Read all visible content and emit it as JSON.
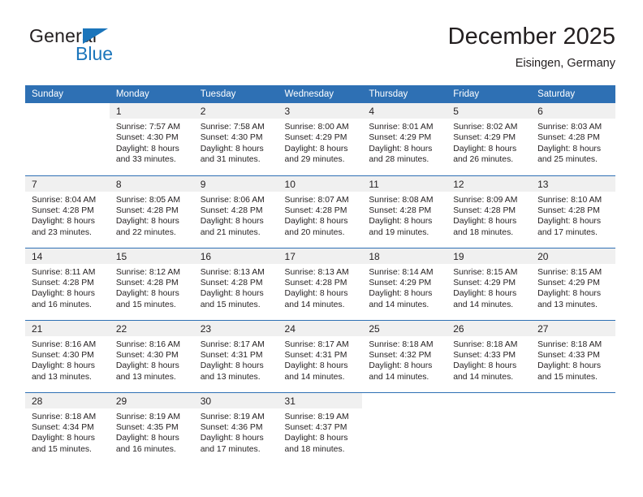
{
  "brand": {
    "name_top": "General",
    "name_bottom": "Blue",
    "triangle_color": "#1b75bb"
  },
  "header": {
    "title": "December 2025",
    "subtitle": "Eisingen, Germany"
  },
  "theme": {
    "header_blue": "#2e70b4",
    "daynum_band": "#f0f0f0",
    "text": "#231f20"
  },
  "weekdays": [
    "Sunday",
    "Monday",
    "Tuesday",
    "Wednesday",
    "Thursday",
    "Friday",
    "Saturday"
  ],
  "weeks": [
    [
      {
        "day": "",
        "lines": []
      },
      {
        "day": "1",
        "lines": [
          "Sunrise: 7:57 AM",
          "Sunset: 4:30 PM",
          "Daylight: 8 hours",
          "and 33 minutes."
        ]
      },
      {
        "day": "2",
        "lines": [
          "Sunrise: 7:58 AM",
          "Sunset: 4:30 PM",
          "Daylight: 8 hours",
          "and 31 minutes."
        ]
      },
      {
        "day": "3",
        "lines": [
          "Sunrise: 8:00 AM",
          "Sunset: 4:29 PM",
          "Daylight: 8 hours",
          "and 29 minutes."
        ]
      },
      {
        "day": "4",
        "lines": [
          "Sunrise: 8:01 AM",
          "Sunset: 4:29 PM",
          "Daylight: 8 hours",
          "and 28 minutes."
        ]
      },
      {
        "day": "5",
        "lines": [
          "Sunrise: 8:02 AM",
          "Sunset: 4:29 PM",
          "Daylight: 8 hours",
          "and 26 minutes."
        ]
      },
      {
        "day": "6",
        "lines": [
          "Sunrise: 8:03 AM",
          "Sunset: 4:28 PM",
          "Daylight: 8 hours",
          "and 25 minutes."
        ]
      }
    ],
    [
      {
        "day": "7",
        "lines": [
          "Sunrise: 8:04 AM",
          "Sunset: 4:28 PM",
          "Daylight: 8 hours",
          "and 23 minutes."
        ]
      },
      {
        "day": "8",
        "lines": [
          "Sunrise: 8:05 AM",
          "Sunset: 4:28 PM",
          "Daylight: 8 hours",
          "and 22 minutes."
        ]
      },
      {
        "day": "9",
        "lines": [
          "Sunrise: 8:06 AM",
          "Sunset: 4:28 PM",
          "Daylight: 8 hours",
          "and 21 minutes."
        ]
      },
      {
        "day": "10",
        "lines": [
          "Sunrise: 8:07 AM",
          "Sunset: 4:28 PM",
          "Daylight: 8 hours",
          "and 20 minutes."
        ]
      },
      {
        "day": "11",
        "lines": [
          "Sunrise: 8:08 AM",
          "Sunset: 4:28 PM",
          "Daylight: 8 hours",
          "and 19 minutes."
        ]
      },
      {
        "day": "12",
        "lines": [
          "Sunrise: 8:09 AM",
          "Sunset: 4:28 PM",
          "Daylight: 8 hours",
          "and 18 minutes."
        ]
      },
      {
        "day": "13",
        "lines": [
          "Sunrise: 8:10 AM",
          "Sunset: 4:28 PM",
          "Daylight: 8 hours",
          "and 17 minutes."
        ]
      }
    ],
    [
      {
        "day": "14",
        "lines": [
          "Sunrise: 8:11 AM",
          "Sunset: 4:28 PM",
          "Daylight: 8 hours",
          "and 16 minutes."
        ]
      },
      {
        "day": "15",
        "lines": [
          "Sunrise: 8:12 AM",
          "Sunset: 4:28 PM",
          "Daylight: 8 hours",
          "and 15 minutes."
        ]
      },
      {
        "day": "16",
        "lines": [
          "Sunrise: 8:13 AM",
          "Sunset: 4:28 PM",
          "Daylight: 8 hours",
          "and 15 minutes."
        ]
      },
      {
        "day": "17",
        "lines": [
          "Sunrise: 8:13 AM",
          "Sunset: 4:28 PM",
          "Daylight: 8 hours",
          "and 14 minutes."
        ]
      },
      {
        "day": "18",
        "lines": [
          "Sunrise: 8:14 AM",
          "Sunset: 4:29 PM",
          "Daylight: 8 hours",
          "and 14 minutes."
        ]
      },
      {
        "day": "19",
        "lines": [
          "Sunrise: 8:15 AM",
          "Sunset: 4:29 PM",
          "Daylight: 8 hours",
          "and 14 minutes."
        ]
      },
      {
        "day": "20",
        "lines": [
          "Sunrise: 8:15 AM",
          "Sunset: 4:29 PM",
          "Daylight: 8 hours",
          "and 13 minutes."
        ]
      }
    ],
    [
      {
        "day": "21",
        "lines": [
          "Sunrise: 8:16 AM",
          "Sunset: 4:30 PM",
          "Daylight: 8 hours",
          "and 13 minutes."
        ]
      },
      {
        "day": "22",
        "lines": [
          "Sunrise: 8:16 AM",
          "Sunset: 4:30 PM",
          "Daylight: 8 hours",
          "and 13 minutes."
        ]
      },
      {
        "day": "23",
        "lines": [
          "Sunrise: 8:17 AM",
          "Sunset: 4:31 PM",
          "Daylight: 8 hours",
          "and 13 minutes."
        ]
      },
      {
        "day": "24",
        "lines": [
          "Sunrise: 8:17 AM",
          "Sunset: 4:31 PM",
          "Daylight: 8 hours",
          "and 14 minutes."
        ]
      },
      {
        "day": "25",
        "lines": [
          "Sunrise: 8:18 AM",
          "Sunset: 4:32 PM",
          "Daylight: 8 hours",
          "and 14 minutes."
        ]
      },
      {
        "day": "26",
        "lines": [
          "Sunrise: 8:18 AM",
          "Sunset: 4:33 PM",
          "Daylight: 8 hours",
          "and 14 minutes."
        ]
      },
      {
        "day": "27",
        "lines": [
          "Sunrise: 8:18 AM",
          "Sunset: 4:33 PM",
          "Daylight: 8 hours",
          "and 15 minutes."
        ]
      }
    ],
    [
      {
        "day": "28",
        "lines": [
          "Sunrise: 8:18 AM",
          "Sunset: 4:34 PM",
          "Daylight: 8 hours",
          "and 15 minutes."
        ]
      },
      {
        "day": "29",
        "lines": [
          "Sunrise: 8:19 AM",
          "Sunset: 4:35 PM",
          "Daylight: 8 hours",
          "and 16 minutes."
        ]
      },
      {
        "day": "30",
        "lines": [
          "Sunrise: 8:19 AM",
          "Sunset: 4:36 PM",
          "Daylight: 8 hours",
          "and 17 minutes."
        ]
      },
      {
        "day": "31",
        "lines": [
          "Sunrise: 8:19 AM",
          "Sunset: 4:37 PM",
          "Daylight: 8 hours",
          "and 18 minutes."
        ]
      },
      {
        "day": "",
        "lines": []
      },
      {
        "day": "",
        "lines": []
      },
      {
        "day": "",
        "lines": []
      }
    ]
  ]
}
